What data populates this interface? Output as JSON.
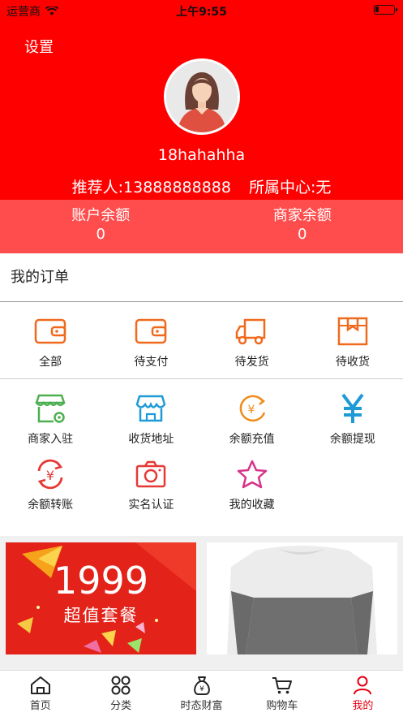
{
  "status_bar": {
    "carrier": "运营商",
    "time": "上午9:55",
    "battery_level": 0.2
  },
  "header": {
    "settings_label": "设置",
    "username": "18hahahha",
    "referrer": "推荐人:13888888888",
    "center": "所属中心:无"
  },
  "balances": [
    {
      "label": "账户余额",
      "value": "0"
    },
    {
      "label": "商家余额",
      "value": "0"
    }
  ],
  "orders": {
    "title": "我的订单",
    "items": [
      {
        "label": "全部",
        "icon": "wallet-icon"
      },
      {
        "label": "待支付",
        "icon": "wallet-icon"
      },
      {
        "label": "待发货",
        "icon": "truck-icon"
      },
      {
        "label": "待收货",
        "icon": "package-icon"
      }
    ]
  },
  "services": [
    {
      "label": "商家入驻",
      "icon": "store-settings-icon",
      "color": "#4caf50"
    },
    {
      "label": "收货地址",
      "icon": "shop-icon",
      "color": "#1e9bd7"
    },
    {
      "label": "余额充值",
      "icon": "yen-recharge-icon",
      "color": "#f08c1a"
    },
    {
      "label": "余额提现",
      "icon": "yen-icon",
      "color": "#1e9bd7"
    },
    {
      "label": "余额转账",
      "icon": "yen-transfer-icon",
      "color": "#e53935"
    },
    {
      "label": "实名认证",
      "icon": "camera-icon",
      "color": "#e53935"
    },
    {
      "label": "我的收藏",
      "icon": "star-icon",
      "color": "#d6338a"
    }
  ],
  "promo": {
    "price": "1999",
    "subtitle": "超值套餐"
  },
  "tabbar": [
    {
      "label": "首页",
      "icon": "home-icon"
    },
    {
      "label": "分类",
      "icon": "category-icon"
    },
    {
      "label": "时态财富",
      "icon": "money-bag-icon"
    },
    {
      "label": "购物车",
      "icon": "cart-icon"
    },
    {
      "label": "我的",
      "icon": "user-icon",
      "active": true
    }
  ],
  "colors": {
    "brand": "#ff0000",
    "balance_bg": "#ff4d4d",
    "order_icon": "#f06a1e",
    "active_tab": "#e60012"
  }
}
